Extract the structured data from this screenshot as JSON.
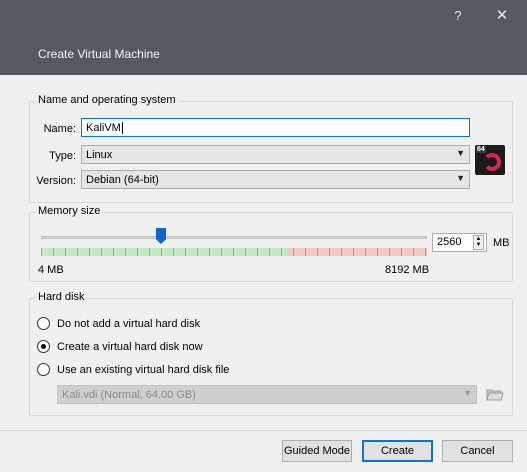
{
  "window": {
    "title": "Create Virtual Machine",
    "help_label": "?",
    "close_label": "✕"
  },
  "name_os": {
    "legend": "Name and operating system",
    "name_label": "Name:",
    "name_value": "KaliVM",
    "type_label": "Type:",
    "type_value": "Linux",
    "version_label": "Version:",
    "version_value": "Debian (64-bit)",
    "os_icon_badge": "64",
    "os_icon": "debian-swirl-icon"
  },
  "memory": {
    "legend": "Memory size",
    "min_label": "4 MB",
    "max_label": "8192 MB",
    "value": "2560",
    "unit": "MB",
    "slider_fraction": 0.3125
  },
  "hard_disk": {
    "legend": "Hard disk",
    "options": [
      {
        "label": "Do not add a virtual hard disk",
        "checked": false
      },
      {
        "label": "Create a virtual hard disk now",
        "checked": true
      },
      {
        "label": "Use an existing virtual hard disk file",
        "checked": false
      }
    ],
    "file_value": "Kali.vdi (Normal, 64.00 GB)",
    "folder_icon": "folder-browse-icon"
  },
  "buttons": {
    "guided": "Guided Mode",
    "create": "Create",
    "cancel": "Cancel"
  },
  "colors": {
    "titlebar": "#555a5e",
    "accent": "#0078d7"
  }
}
